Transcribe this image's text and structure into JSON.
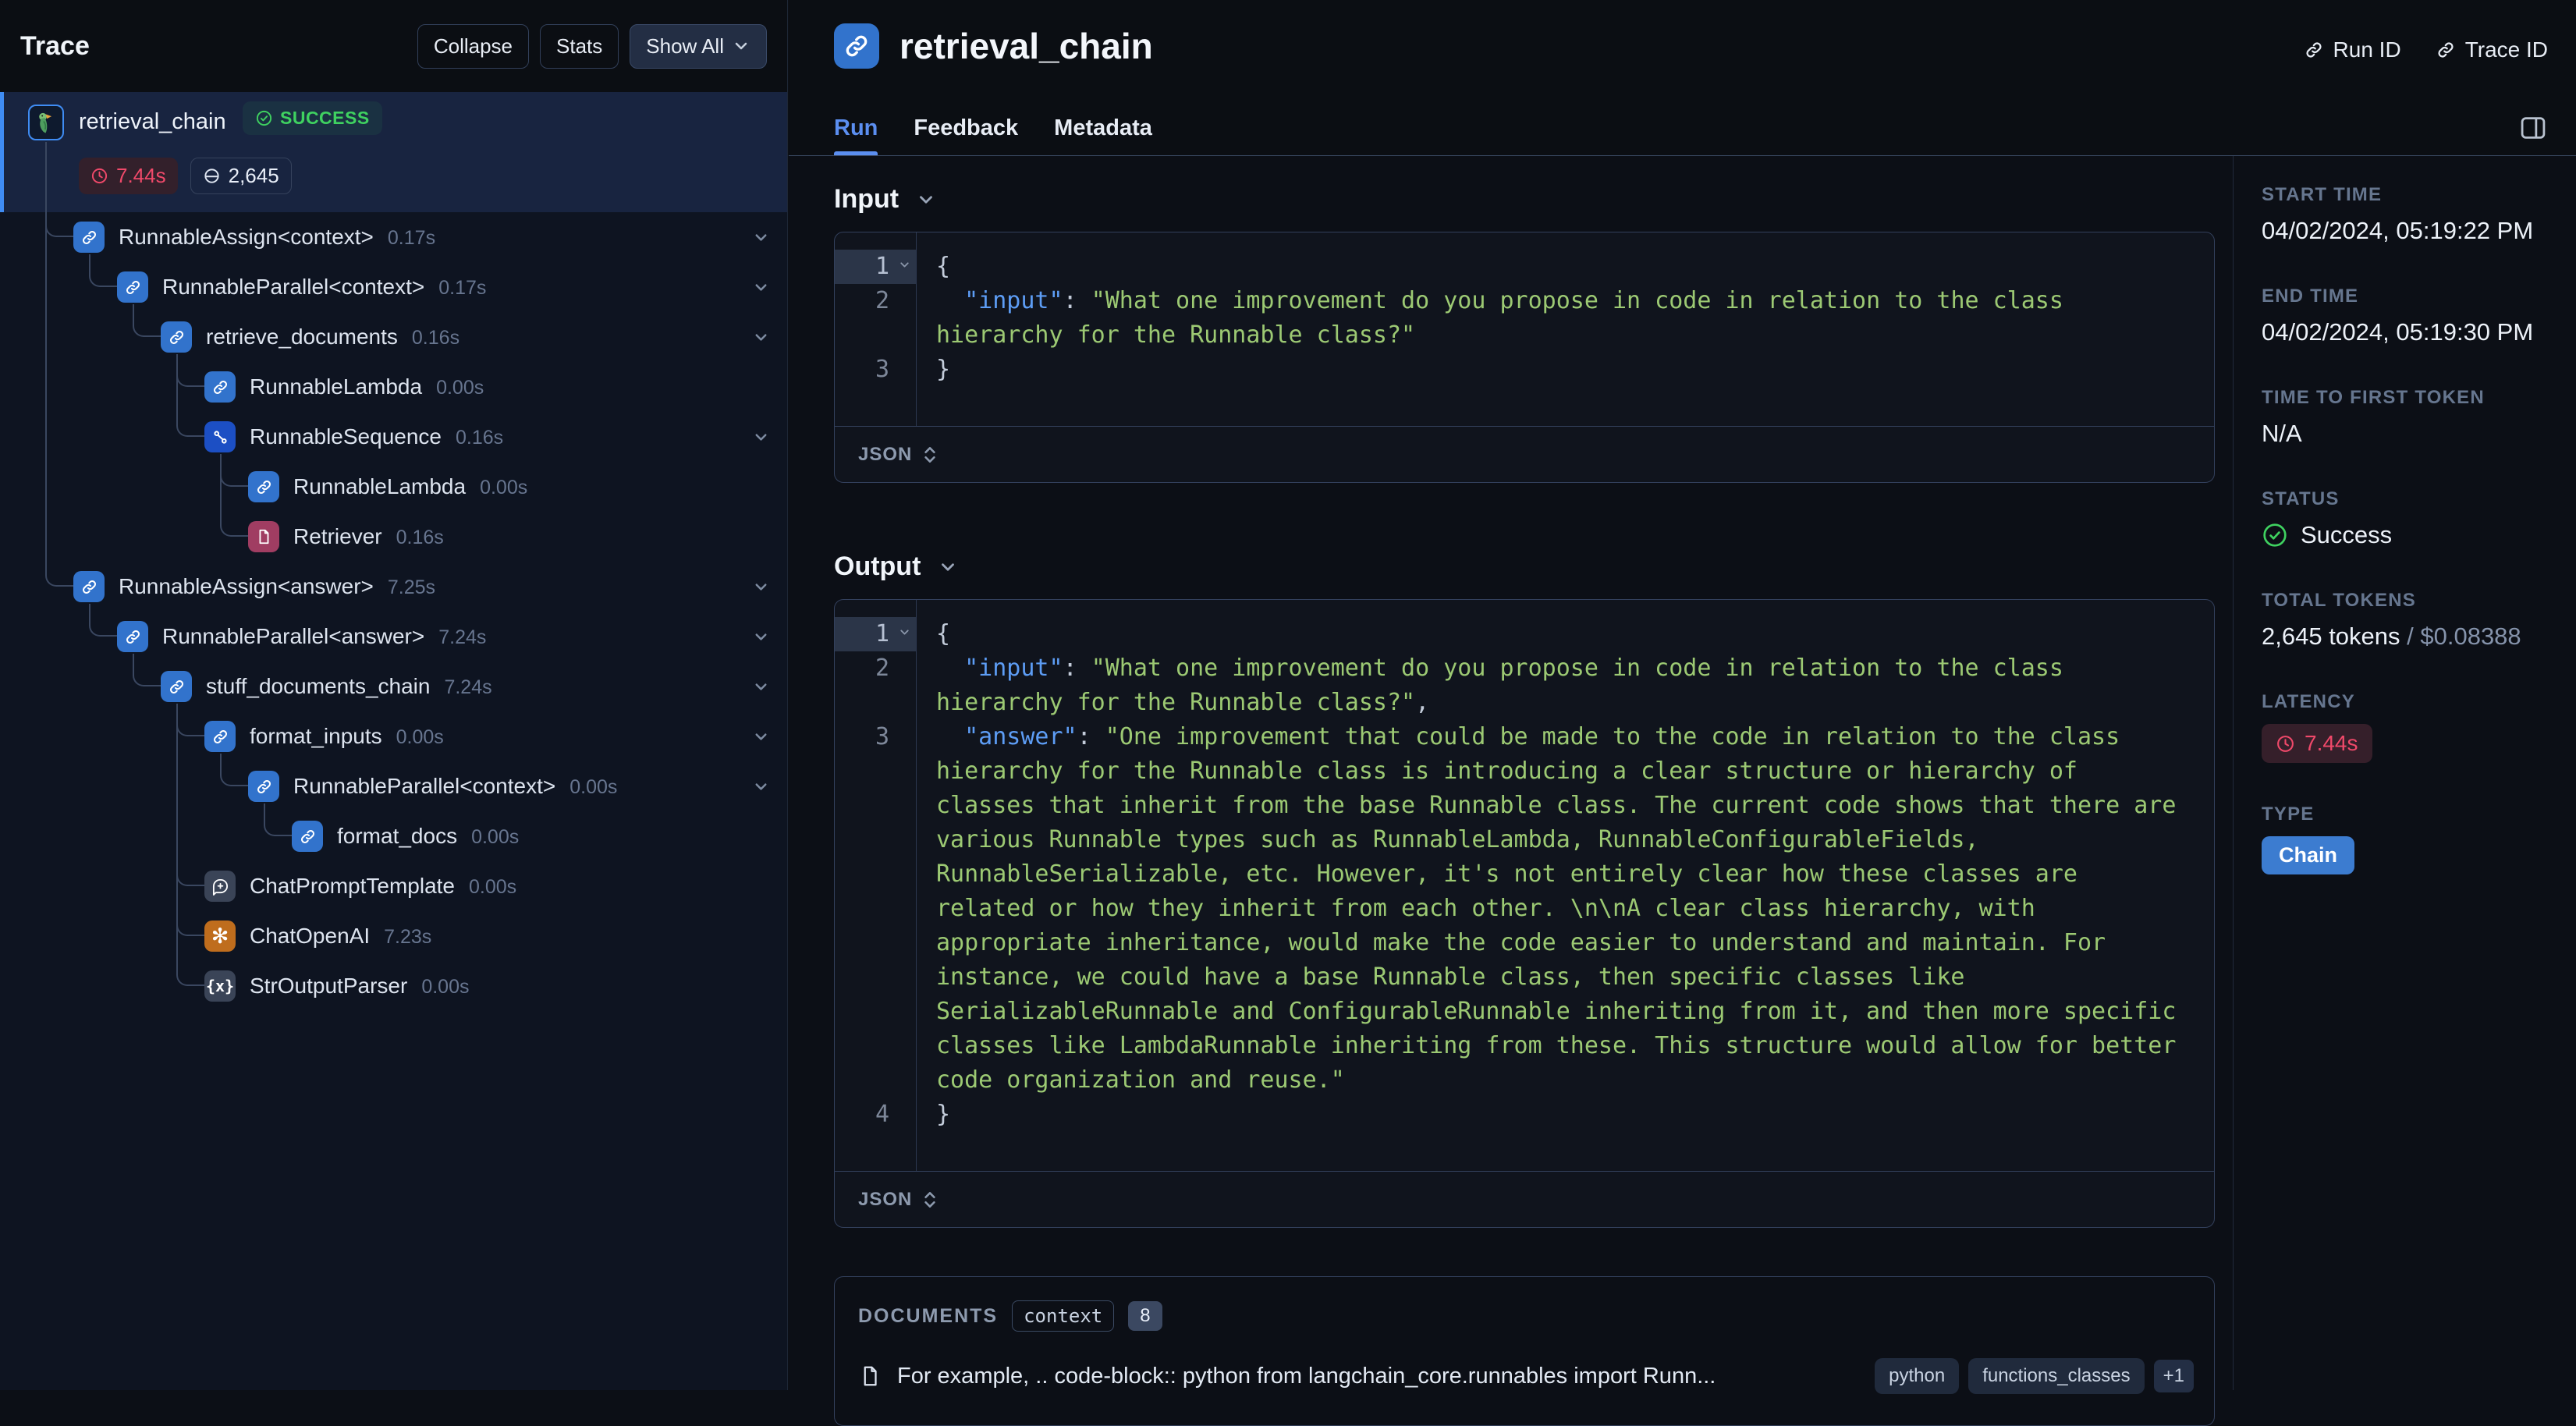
{
  "accent": {
    "blue": "#3f8cf3",
    "green": "#3fd160",
    "red": "#f0496a",
    "type_blue": "#3c7cd0"
  },
  "sidebar": {
    "title": "Trace",
    "collapse_label": "Collapse",
    "stats_label": "Stats",
    "show_all_label": "Show All",
    "root": {
      "name": "retrieval_chain",
      "status": "SUCCESS",
      "latency": "7.44s",
      "tokens": "2,645"
    },
    "tree": [
      {
        "name": "RunnableAssign<context>",
        "duration": "0.17s",
        "icon": "chain-icon",
        "level": 1,
        "chevron": true
      },
      {
        "name": "RunnableParallel<context>",
        "duration": "0.17s",
        "icon": "chain-icon",
        "level": 2,
        "chevron": true
      },
      {
        "name": "retrieve_documents",
        "duration": "0.16s",
        "icon": "chain-icon",
        "level": 3,
        "chevron": true
      },
      {
        "name": "RunnableLambda",
        "duration": "0.00s",
        "icon": "chain-icon",
        "level": 4,
        "chevron": false
      },
      {
        "name": "RunnableSequence",
        "duration": "0.16s",
        "icon": "sequence-icon",
        "level": 4,
        "chevron": true
      },
      {
        "name": "RunnableLambda",
        "duration": "0.00s",
        "icon": "chain-icon",
        "level": 5,
        "chevron": false
      },
      {
        "name": "Retriever",
        "duration": "0.16s",
        "icon": "retriever-icon",
        "level": 5,
        "chevron": false
      },
      {
        "name": "RunnableAssign<answer>",
        "duration": "7.25s",
        "icon": "chain-icon",
        "level": 1,
        "chevron": true
      },
      {
        "name": "RunnableParallel<answer>",
        "duration": "7.24s",
        "icon": "chain-icon",
        "level": 2,
        "chevron": true
      },
      {
        "name": "stuff_documents_chain",
        "duration": "7.24s",
        "icon": "chain-icon",
        "level": 3,
        "chevron": true
      },
      {
        "name": "format_inputs",
        "duration": "0.00s",
        "icon": "chain-icon",
        "level": 4,
        "chevron": true
      },
      {
        "name": "RunnableParallel<context>",
        "duration": "0.00s",
        "icon": "chain-icon",
        "level": 5,
        "chevron": true
      },
      {
        "name": "format_docs",
        "duration": "0.00s",
        "icon": "chain-icon",
        "level": 6,
        "chevron": false
      },
      {
        "name": "ChatPromptTemplate",
        "duration": "0.00s",
        "icon": "prompt-icon",
        "level": 4,
        "chevron": false
      },
      {
        "name": "ChatOpenAI",
        "duration": "7.23s",
        "icon": "openai-icon",
        "level": 4,
        "chevron": false
      },
      {
        "name": "StrOutputParser",
        "duration": "0.00s",
        "icon": "parser-icon",
        "level": 4,
        "chevron": false
      }
    ]
  },
  "header": {
    "title": "retrieval_chain",
    "run_id_label": "Run ID",
    "trace_id_label": "Trace ID",
    "tabs": [
      {
        "label": "Run",
        "active": true
      },
      {
        "label": "Feedback",
        "active": false
      },
      {
        "label": "Metadata",
        "active": false
      }
    ]
  },
  "input_section": {
    "title": "Input",
    "format_label": "JSON",
    "lines": [
      {
        "num": "1",
        "fold": true,
        "segments": [
          {
            "t": "{",
            "c": "p"
          }
        ]
      },
      {
        "num": "2",
        "fold": false,
        "segments": [
          {
            "t": "  ",
            "c": "p"
          },
          {
            "t": "\"input\"",
            "c": "k"
          },
          {
            "t": ": ",
            "c": "p"
          },
          {
            "t": "\"What one improvement do you propose in code in relation to the class hierarchy for the Runnable class?\"",
            "c": "s"
          }
        ]
      },
      {
        "num": "3",
        "fold": false,
        "segments": [
          {
            "t": "}",
            "c": "p"
          }
        ]
      }
    ]
  },
  "output_section": {
    "title": "Output",
    "format_label": "JSON",
    "lines": [
      {
        "num": "1",
        "fold": true,
        "segments": [
          {
            "t": "{",
            "c": "p"
          }
        ]
      },
      {
        "num": "2",
        "fold": false,
        "segments": [
          {
            "t": "  ",
            "c": "p"
          },
          {
            "t": "\"input\"",
            "c": "k"
          },
          {
            "t": ": ",
            "c": "p"
          },
          {
            "t": "\"What one improvement do you propose in code in relation to the class hierarchy for the Runnable class?\"",
            "c": "s"
          },
          {
            "t": ",",
            "c": "p"
          }
        ]
      },
      {
        "num": "3",
        "fold": false,
        "segments": [
          {
            "t": "  ",
            "c": "p"
          },
          {
            "t": "\"answer\"",
            "c": "k"
          },
          {
            "t": ": ",
            "c": "p"
          },
          {
            "t": "\"One improvement that could be made to the code in relation to the class hierarchy for the Runnable class is introducing a clear structure or hierarchy of classes that inherit from the base Runnable class. The current code shows that there are various Runnable types such as RunnableLambda, RunnableConfigurableFields, RunnableSerializable, etc. However, it's not entirely clear how these classes are related or how they inherit from each other. \\n\\nA clear class hierarchy, with appropriate inheritance, would make the code easier to understand and maintain. For instance, we could have a base Runnable class, then specific classes like SerializableRunnable and ConfigurableRunnable inheriting from it, and then more specific classes like LambdaRunnable inheriting from these. This structure would allow for better code organization and reuse.\"",
            "c": "s"
          }
        ]
      },
      {
        "num": "4",
        "fold": false,
        "segments": [
          {
            "t": "}",
            "c": "p"
          }
        ]
      }
    ]
  },
  "documents_section": {
    "label": "DOCUMENTS",
    "key_badge": "context",
    "count_badge": "8",
    "doc": {
      "text": "For example, .. code-block:: python from langchain_core.runnables import Runn...",
      "tags": [
        "python",
        "functions_classes"
      ],
      "more": "+1"
    }
  },
  "rightbar": {
    "fields": [
      {
        "label": "START TIME",
        "type": "text",
        "value": "04/02/2024, 05:19:22 PM"
      },
      {
        "label": "END TIME",
        "type": "text",
        "value": "04/02/2024, 05:19:30 PM"
      },
      {
        "label": "TIME TO FIRST TOKEN",
        "type": "text",
        "value": "N/A"
      },
      {
        "label": "STATUS",
        "type": "status",
        "value": "Success"
      },
      {
        "label": "TOTAL TOKENS",
        "type": "tokens",
        "value": "2,645 tokens",
        "extra": " / $0.08388"
      },
      {
        "label": "LATENCY",
        "type": "latency",
        "value": "7.44s"
      },
      {
        "label": "TYPE",
        "type": "type",
        "value": "Chain"
      }
    ]
  }
}
